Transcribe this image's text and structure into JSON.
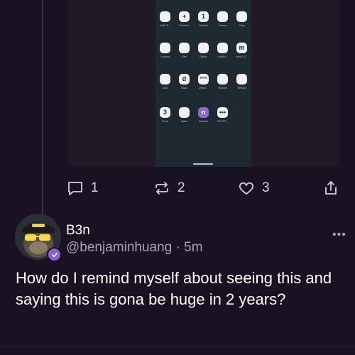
{
  "media": {
    "apps": [
      [
        {
          "label": "Audio R...",
          "icon": "audio-recorder-icon",
          "glyph": ""
        },
        {
          "label": "Calculator",
          "icon": "calculator-icon",
          "glyph": "+"
        },
        {
          "label": "Calendar",
          "icon": "calendar-icon",
          "glyph": "1"
        },
        {
          "label": "Camera",
          "icon": "camera-icon",
          "glyph": ""
        },
        {
          "label": "Clock",
          "icon": "clock-icon",
          "glyph": ""
        }
      ],
      [
        {
          "label": "Contacts",
          "icon": "contacts-icon",
          "glyph": ""
        },
        {
          "label": "Files",
          "icon": "files-icon",
          "glyph": ""
        },
        {
          "label": "Gallery",
          "icon": "gallery-icon",
          "glyph": ""
        },
        {
          "label": "LightBo...",
          "icon": "lightbox-icon",
          "glyph": ""
        },
        {
          "label": "microG S...",
          "icon": "microg-icon",
          "glyph": "m"
        }
      ],
      [
        {
          "label": "MAX",
          "icon": "max-icon",
          "glyph": ""
        },
        {
          "label": "Music",
          "icon": "music-icon",
          "glyph": "d"
        },
        {
          "label": "Messe...",
          "icon": "messages-icon",
          "glyph": "°°°"
        },
        {
          "label": "Recorder",
          "icon": "recorder-icon",
          "glyph": ""
        },
        {
          "label": "Settings",
          "icon": "settings-icon",
          "glyph": ""
        }
      ],
      [
        {
          "label": "Three",
          "icon": "three-icon",
          "glyph": "3"
        },
        {
          "label": "Wallet",
          "icon": "wallet-icon",
          "glyph": ""
        },
        {
          "label": "Webcam",
          "icon": "webcam-icon",
          "glyph": "n"
        },
        {
          "label": "WXTPS...",
          "icon": "wxtps-icon",
          "glyph": "•••"
        }
      ]
    ]
  },
  "actions": {
    "replies": "1",
    "recasts": "2",
    "likes": "3"
  },
  "reply": {
    "display_name": "B3n",
    "handle": "@benjaminhuang",
    "separator": "·",
    "time": "5m",
    "more": "•••",
    "text": "How do I remind myself about seeing this and saying this is gona be huge in 2 years?"
  },
  "colors": {
    "background": "#1a1223",
    "verified": "#8a63d2",
    "muted_text": "#a8a1b4"
  }
}
